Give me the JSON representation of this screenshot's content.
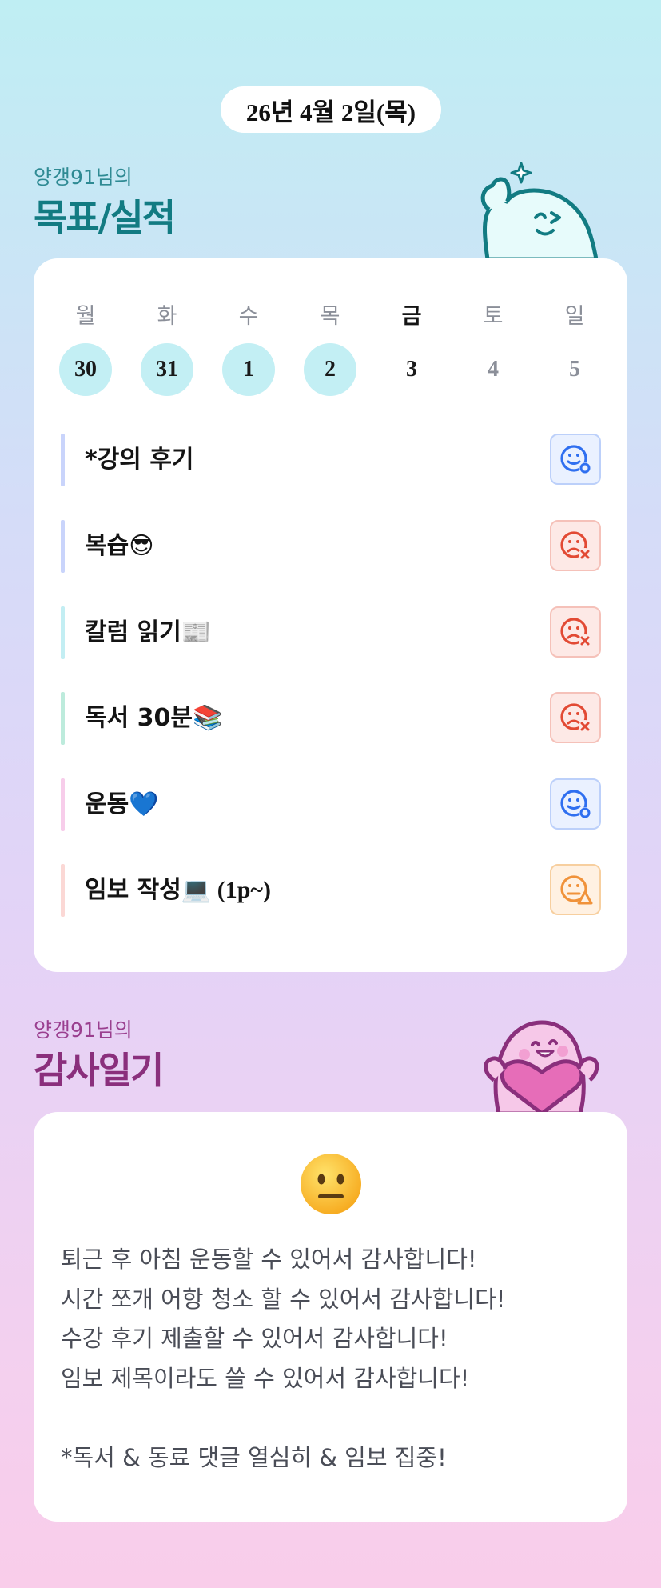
{
  "date_label": "26년 4월 2일(목)",
  "goals_section": {
    "subtitle": "양갱91님의",
    "title": "목표/실적"
  },
  "week": [
    {
      "day": "월",
      "date": "30",
      "state": "done",
      "today": false
    },
    {
      "day": "화",
      "date": "31",
      "state": "done",
      "today": false
    },
    {
      "day": "수",
      "date": "1",
      "state": "done",
      "today": false
    },
    {
      "day": "목",
      "date": "2",
      "state": "done",
      "today": false
    },
    {
      "day": "금",
      "date": "3",
      "state": "plain",
      "today": true
    },
    {
      "day": "토",
      "date": "4",
      "state": "future",
      "today": false
    },
    {
      "day": "일",
      "date": "5",
      "state": "future",
      "today": false
    }
  ],
  "goals": [
    {
      "label": "*강의 후기",
      "emoji": "",
      "suffix": "",
      "bar_color": "#c9d4fb",
      "status": "good",
      "status_icon": "smile-check-icon"
    },
    {
      "label": "복습",
      "emoji": "😎",
      "suffix": "",
      "bar_color": "#c9d4fb",
      "status": "bad",
      "status_icon": "frown-x-icon"
    },
    {
      "label": "칼럼 읽기",
      "emoji": "📰",
      "suffix": "",
      "bar_color": "#c3eef3",
      "status": "bad",
      "status_icon": "frown-x-icon"
    },
    {
      "label": "독서 30분",
      "emoji": "📚",
      "suffix": "",
      "bar_color": "#bdebdc",
      "status": "bad",
      "status_icon": "frown-x-icon"
    },
    {
      "label": "운동",
      "emoji": "💙",
      "suffix": "",
      "bar_color": "#f7cdea",
      "status": "good",
      "status_icon": "smile-check-icon"
    },
    {
      "label": "임보 작성",
      "emoji": "💻",
      "suffix": " (1p~)",
      "bar_color": "#fbd8d5",
      "status": "meh",
      "status_icon": "neutral-warning-icon"
    }
  ],
  "thanks_section": {
    "subtitle": "양갱91님의",
    "title": "감사일기"
  },
  "thanks": {
    "mood_emoji": "😐",
    "mood_icon": "neutral-face-icon",
    "lines": [
      "퇴근 후 아침 운동할 수 있어서 감사합니다!",
      "시간 쪼개 어항 청소 할 수 있어서 감사합니다!",
      "수강 후기 제출할 수 있어서 감사합니다!",
      "임보 제목이라도 쓸 수 있어서 감사합니다!",
      "",
      "*독서 & 동료 댓글 열심히 & 임보 집중!"
    ]
  },
  "colors": {
    "good": "#2f6ff0",
    "bad": "#e24a34",
    "meh": "#f0923a",
    "goals_title": "#127b82",
    "thanks_title": "#8a2f7c"
  }
}
